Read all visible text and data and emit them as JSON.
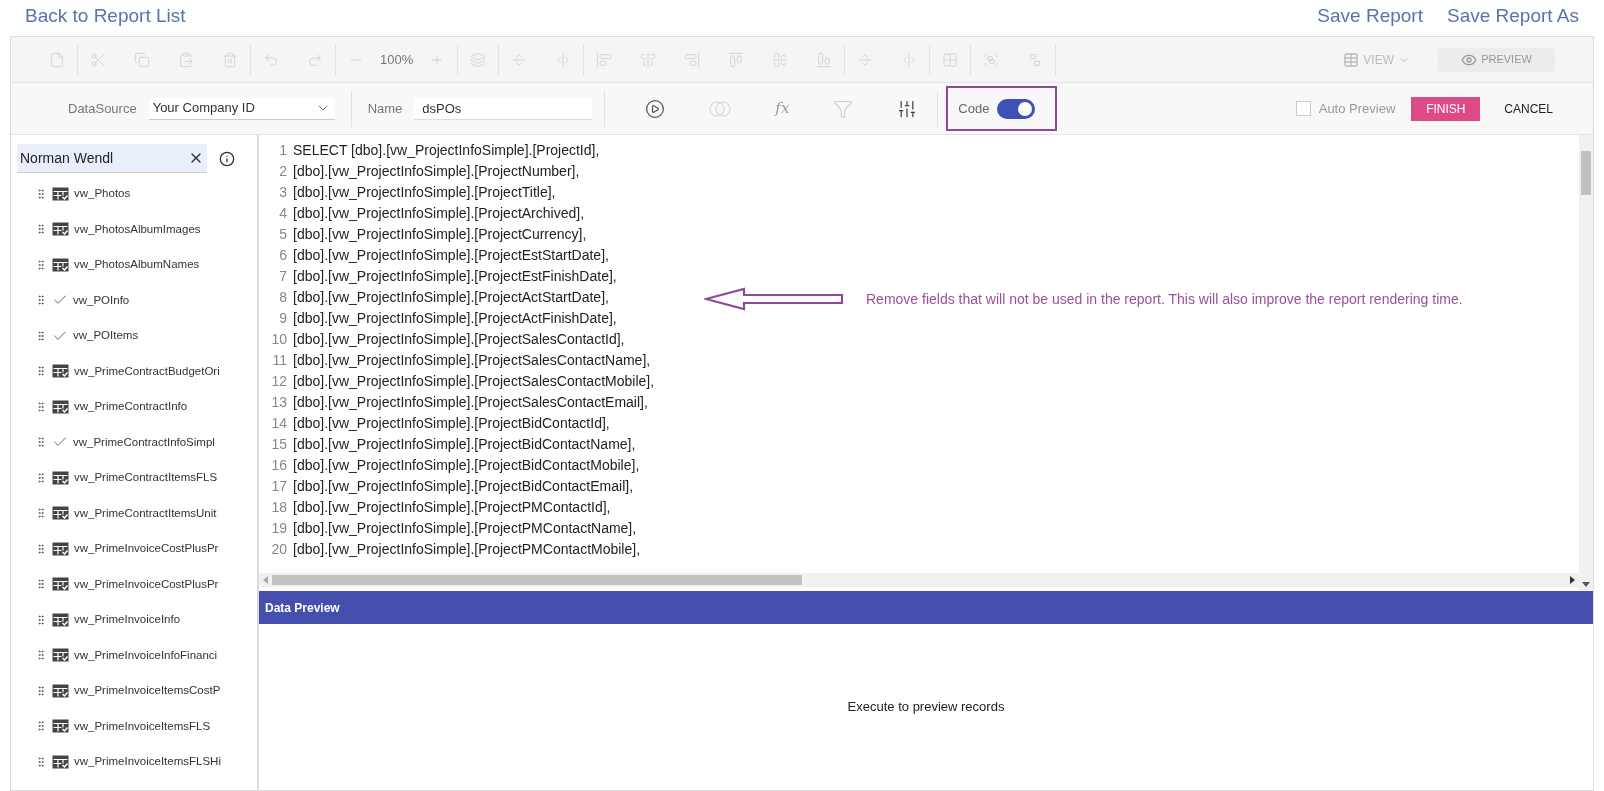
{
  "top_links": {
    "back": "Back to Report List",
    "actions": [
      "Save Report",
      "Save Report As"
    ]
  },
  "toolbar": {
    "zoom": "100%",
    "view": "VIEW",
    "preview": "PREVIEW"
  },
  "query_bar": {
    "datasource_label": "DataSource",
    "datasource_value": "Your Company ID",
    "name_label": "Name",
    "name_value": "dsPOs",
    "function_glyph": "fx",
    "code_label": "Code",
    "code_on": true,
    "auto_preview": {
      "label": "Auto Preview",
      "checked": false
    },
    "finish": "FINISH",
    "cancel": "CANCEL"
  },
  "sidebar": {
    "search_value": "Norman Wendl",
    "items": [
      {
        "name": "vw_Photos",
        "kind": "table"
      },
      {
        "name": "vw_PhotosAlbumImages",
        "kind": "table"
      },
      {
        "name": "vw_PhotosAlbumNames",
        "kind": "table"
      },
      {
        "name": "vw_POInfo",
        "kind": "checked"
      },
      {
        "name": "vw_POItems",
        "kind": "checked"
      },
      {
        "name": "vw_PrimeContractBudgetOri",
        "kind": "table"
      },
      {
        "name": "vw_PrimeContractInfo",
        "kind": "table"
      },
      {
        "name": "vw_PrimeContractInfoSimpl",
        "kind": "checked"
      },
      {
        "name": "vw_PrimeContractItemsFLS",
        "kind": "table"
      },
      {
        "name": "vw_PrimeContractItemsUnit",
        "kind": "table"
      },
      {
        "name": "vw_PrimeInvoiceCostPlusPr",
        "kind": "table"
      },
      {
        "name": "vw_PrimeInvoiceCostPlusPr",
        "kind": "table"
      },
      {
        "name": "vw_PrimeInvoiceInfo",
        "kind": "table"
      },
      {
        "name": "vw_PrimeInvoiceInfoFinanci",
        "kind": "table"
      },
      {
        "name": "vw_PrimeInvoiceItemsCostP",
        "kind": "table"
      },
      {
        "name": "vw_PrimeInvoiceItemsFLS",
        "kind": "table"
      },
      {
        "name": "vw_PrimeInvoiceItemsFLSHi",
        "kind": "table"
      }
    ]
  },
  "code_lines": [
    {
      "number": "1",
      "text": "SELECT [dbo].[vw_ProjectInfoSimple].[ProjectId],"
    },
    {
      "number": "2",
      "text": "[dbo].[vw_ProjectInfoSimple].[ProjectNumber],"
    },
    {
      "number": "3",
      "text": "[dbo].[vw_ProjectInfoSimple].[ProjectTitle],"
    },
    {
      "number": "4",
      "text": "[dbo].[vw_ProjectInfoSimple].[ProjectArchived],"
    },
    {
      "number": "5",
      "text": "[dbo].[vw_ProjectInfoSimple].[ProjectCurrency],"
    },
    {
      "number": "6",
      "text": "[dbo].[vw_ProjectInfoSimple].[ProjectEstStartDate],"
    },
    {
      "number": "7",
      "text": "[dbo].[vw_ProjectInfoSimple].[ProjectEstFinishDate],"
    },
    {
      "number": "8",
      "text": "[dbo].[vw_ProjectInfoSimple].[ProjectActStartDate],"
    },
    {
      "number": "9",
      "text": "[dbo].[vw_ProjectInfoSimple].[ProjectActFinishDate],"
    },
    {
      "number": "10",
      "text": "[dbo].[vw_ProjectInfoSimple].[ProjectSalesContactId],"
    },
    {
      "number": "11",
      "text": "[dbo].[vw_ProjectInfoSimple].[ProjectSalesContactName],"
    },
    {
      "number": "12",
      "text": "[dbo].[vw_ProjectInfoSimple].[ProjectSalesContactMobile],"
    },
    {
      "number": "13",
      "text": "[dbo].[vw_ProjectInfoSimple].[ProjectSalesContactEmail],"
    },
    {
      "number": "14",
      "text": "[dbo].[vw_ProjectInfoSimple].[ProjectBidContactId],"
    },
    {
      "number": "15",
      "text": "[dbo].[vw_ProjectInfoSimple].[ProjectBidContactName],"
    },
    {
      "number": "16",
      "text": "[dbo].[vw_ProjectInfoSimple].[ProjectBidContactMobile],"
    },
    {
      "number": "17",
      "text": "[dbo].[vw_ProjectInfoSimple].[ProjectBidContactEmail],"
    },
    {
      "number": "18",
      "text": "[dbo].[vw_ProjectInfoSimple].[ProjectPMContactId],"
    },
    {
      "number": "19",
      "text": "[dbo].[vw_ProjectInfoSimple].[ProjectPMContactName],"
    },
    {
      "number": "20",
      "text": "[dbo].[vw_ProjectInfoSimple].[ProjectPMContactMobile],"
    }
  ],
  "annotation": "Remove fields that will not be used in the report. This will also improve the report rendering time.",
  "data_preview": {
    "title": "Data Preview",
    "empty_message": "Execute to preview records"
  }
}
